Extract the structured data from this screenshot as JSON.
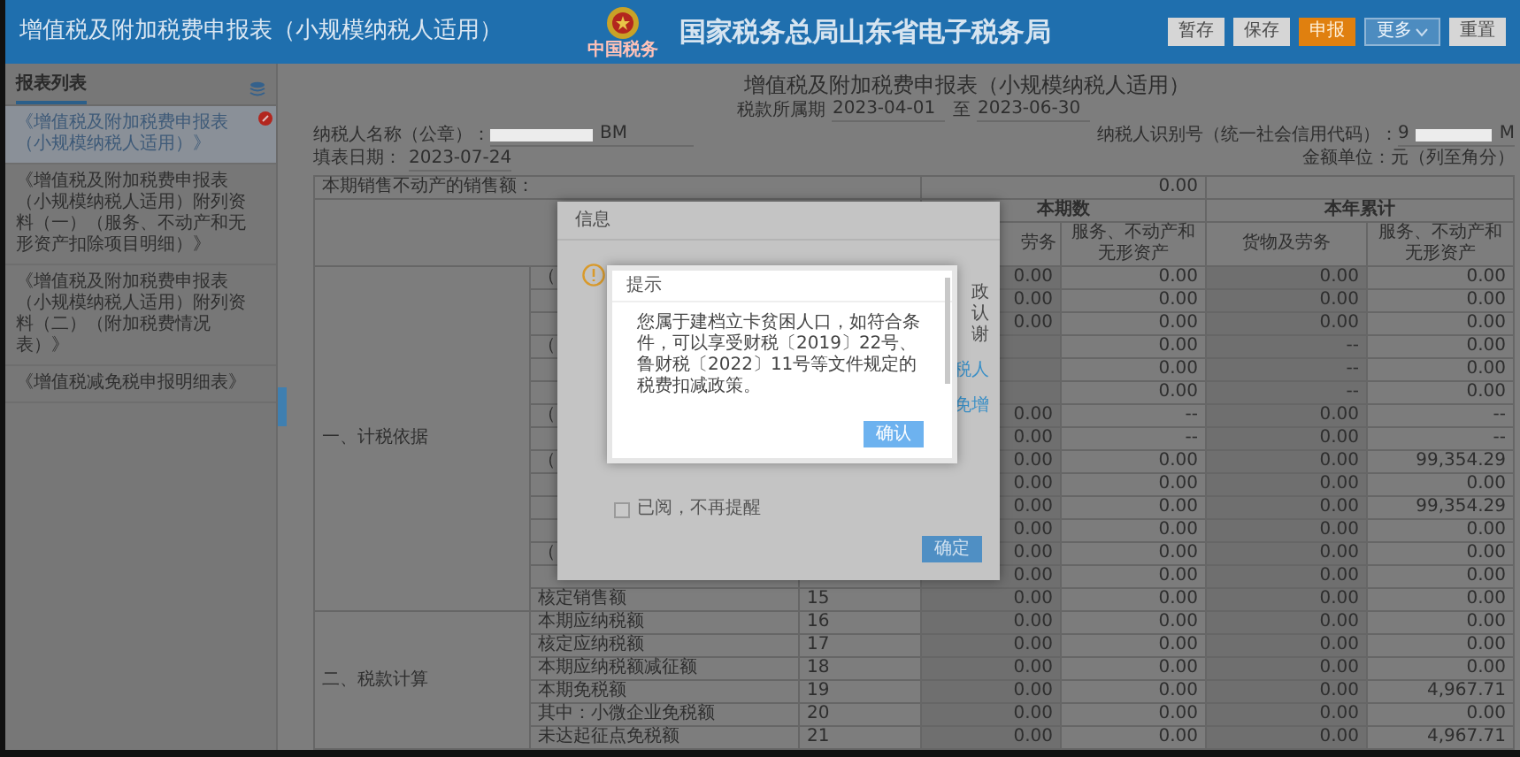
{
  "header": {
    "title": "增值税及附加税费申报表（小规模纳税人适用）",
    "emblem_caption": "中国税务",
    "site_name": "国家税务总局山东省电子税务局",
    "buttons": [
      {
        "label": "暂存",
        "kind": "normal"
      },
      {
        "label": "保存",
        "kind": "normal"
      },
      {
        "label": "申报",
        "kind": "primary"
      },
      {
        "label": "更多",
        "kind": "menu"
      },
      {
        "label": "重置",
        "kind": "normal"
      }
    ]
  },
  "sidebar": {
    "tab": "报表列表",
    "items": [
      {
        "label": "《增值税及附加税费申报表（小规模纳税人适用）》",
        "selected": true,
        "flagged": true
      },
      {
        "label": "《增值税及附加税费申报表（小规模纳税人适用）附列资料（一）（服务、不动产和无形资产扣除项目明细）》",
        "selected": false,
        "flagged": false
      },
      {
        "label": "《增值税及附加税费申报表（小规模纳税人适用）附列资料（二）（附加税费情况表）》",
        "selected": false,
        "flagged": false
      },
      {
        "label": "《增值税减免税申报明细表》",
        "selected": false,
        "flagged": false
      }
    ]
  },
  "form": {
    "title": "增值税及附加税费申报表（小规模纳税人适用）",
    "period_label": "税款所属期",
    "period_start": "2023-04-01",
    "period_sep": "至",
    "period_end": "2023-06-30",
    "taxpayer_name_label": "纳税人名称（公章）：",
    "taxpayer_name_tail": "BM",
    "taxpayer_id_label": "纳税人识别号（统一社会信用代码）：",
    "taxpayer_id_head": "9",
    "taxpayer_id_tail": "M",
    "fill_date_label": "填表日期：",
    "fill_date": "2023-07-24",
    "unit": "金额单位：元（列至角分）"
  },
  "table": {
    "presale_label": "本期销售不动产的销售额：",
    "presale_value": "0.00",
    "period_header": "本期数",
    "ytd_header": "本年累计",
    "subheaders": [
      "劳务",
      "服务、不动产和无形资产",
      "货物及劳务",
      "服务、不动产和无形资产"
    ],
    "groups": [
      {
        "label": "一、计税依据",
        "rows": [
          {
            "item": "（",
            "values": [
              "0.00",
              "0.00",
              "0.00",
              "0.00"
            ]
          },
          {
            "values": [
              "0.00",
              "0.00",
              "0.00",
              "0.00"
            ]
          },
          {
            "values": [
              "0.00",
              "0.00",
              "0.00",
              "0.00"
            ]
          },
          {
            "item": "（",
            "values": {
              "period_services": "0.00",
              "ytd_goods": "--",
              "ytd_services": "0.00"
            }
          },
          {
            "values": {
              "period_services": "0.00",
              "ytd_goods": "--",
              "ytd_services": "0.00"
            }
          },
          {
            "values": {
              "period_services": "0.00",
              "ytd_goods": "--",
              "ytd_services": "0.00"
            }
          },
          {
            "item": "（",
            "values": [
              "0.00",
              "--",
              "0.00",
              "--"
            ]
          },
          {
            "values": [
              "0.00",
              "--",
              "0.00",
              "--"
            ]
          },
          {
            "item": "（",
            "values": [
              "0.00",
              "0.00",
              "0.00",
              "99,354.29"
            ]
          },
          {
            "values": [
              "0.00",
              "0.00",
              "0.00",
              "0.00"
            ]
          },
          {
            "values": [
              "0.00",
              "0.00",
              "0.00",
              "99,354.29"
            ]
          },
          {
            "values": [
              "0.00",
              "0.00",
              "0.00",
              "0.00"
            ]
          },
          {
            "item": "（",
            "values": [
              "0.00",
              "0.00",
              "0.00",
              "0.00"
            ]
          },
          {
            "values": [
              "0.00",
              "0.00",
              "0.00",
              "0.00"
            ]
          },
          {
            "item": "核定销售额",
            "line": "15",
            "values": [
              "0.00",
              "0.00",
              "0.00",
              "0.00"
            ]
          }
        ]
      },
      {
        "label": "二、税款计算",
        "rows": [
          {
            "item": "本期应纳税额",
            "line": "16",
            "values": [
              "0.00",
              "0.00",
              "0.00",
              "0.00"
            ]
          },
          {
            "item": "核定应纳税额",
            "line": "17",
            "values": [
              "0.00",
              "0.00",
              "0.00",
              "0.00"
            ]
          },
          {
            "item": "本期应纳税额减征额",
            "line": "18",
            "values": [
              "0.00",
              "0.00",
              "0.00",
              "0.00"
            ]
          },
          {
            "item": "本期免税额",
            "line": "19",
            "values": [
              "0.00",
              "0.00",
              "0.00",
              "4,967.71"
            ]
          },
          {
            "item": "其中：小微企业免税额",
            "line": "20",
            "values": [
              "0.00",
              "0.00",
              "0.00",
              "0.00"
            ]
          },
          {
            "item": "未达起征点免税额",
            "line": "21",
            "values": [
              "0.00",
              "0.00",
              "0.00",
              "4,967.71"
            ]
          }
        ]
      }
    ]
  },
  "info_dialog": {
    "title": "信息",
    "fragments": [
      {
        "text": "政",
        "kind": "text"
      },
      {
        "text": "认",
        "kind": "text"
      },
      {
        "text": "谢",
        "kind": "text"
      },
      {
        "text": "税人",
        "kind": "link"
      },
      {
        "text": "免增",
        "kind": "link"
      }
    ],
    "checkbox": {
      "label": "已阅，不再提醒",
      "checked": false
    },
    "button": "确定"
  },
  "prompt_dialog": {
    "title": "提示",
    "message": "您属于建档立卡贫困人口，如符合条件，可以享受财税〔2019〕22号、鲁财税〔2022〕11号等文件规定的税费扣减政策。",
    "button": "确认"
  }
}
